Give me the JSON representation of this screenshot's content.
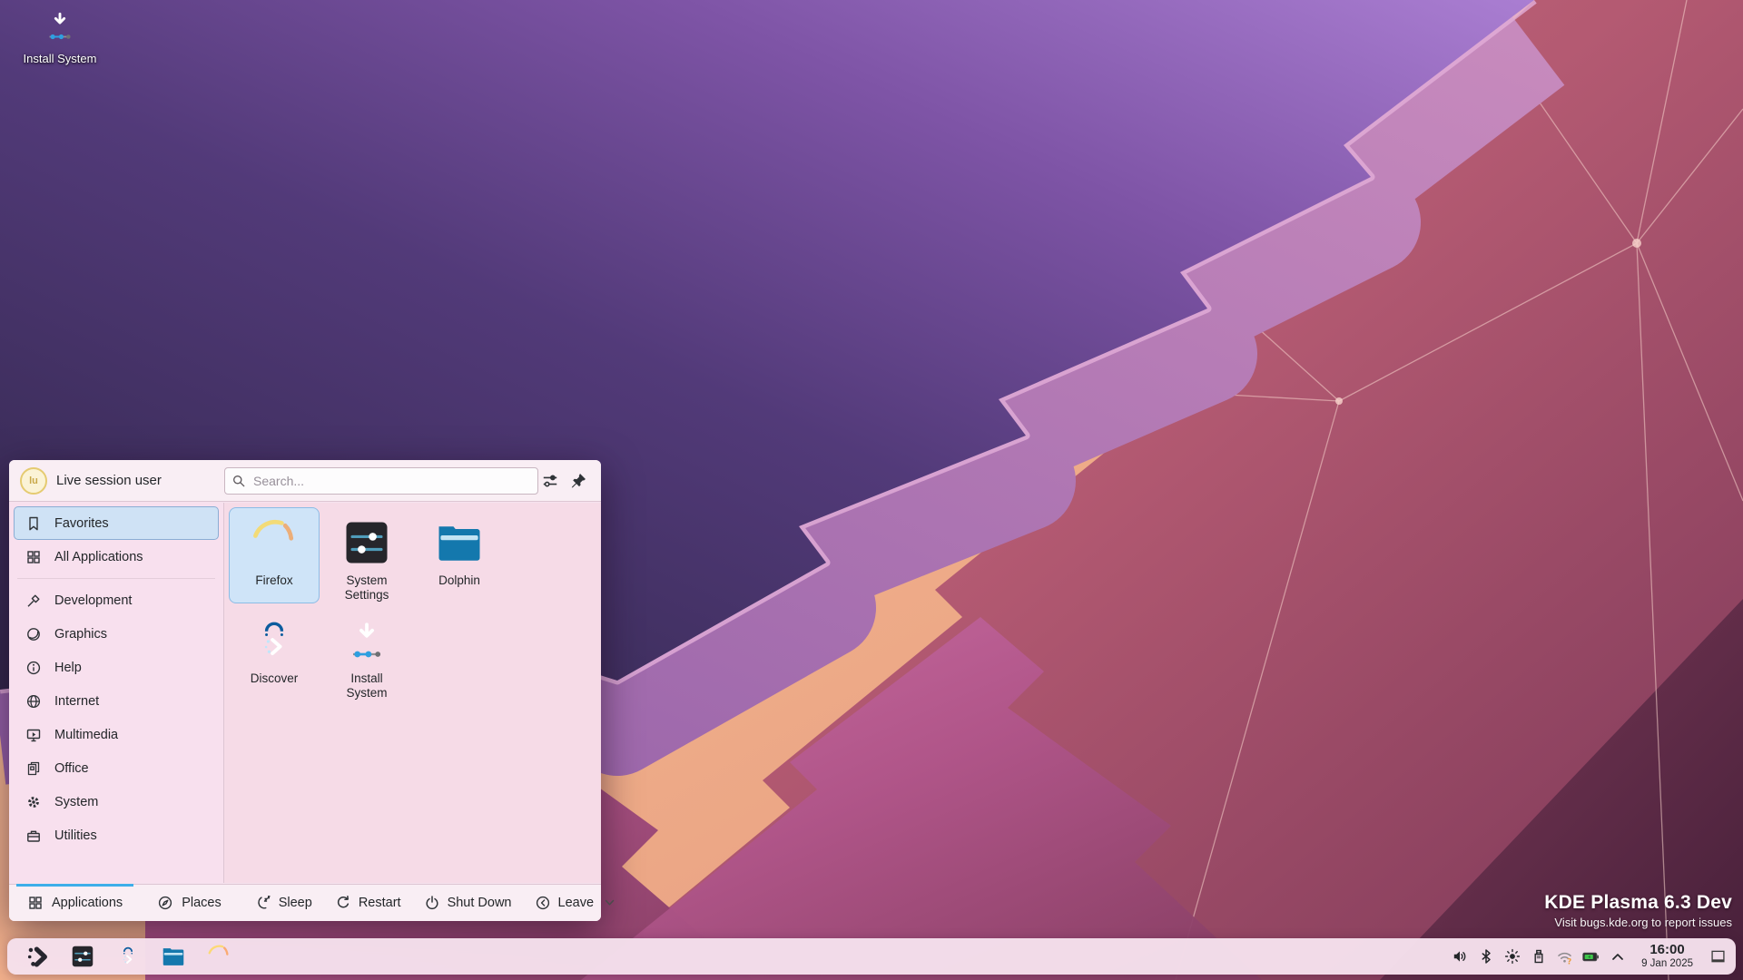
{
  "desktop": {
    "shortcut": {
      "label": "Install System"
    },
    "branding": {
      "title": "KDE Plasma 6.3 Dev",
      "subtitle": "Visit bugs.kde.org to report issues"
    }
  },
  "launcher": {
    "user_name": "Live session user",
    "avatar_initials": "lu",
    "search": {
      "placeholder": "Search..."
    },
    "header_icons": [
      {
        "name": "configure-icon"
      },
      {
        "name": "pin-icon"
      }
    ],
    "sidebar": {
      "items": [
        {
          "label": "Favorites",
          "icon": "bookmark",
          "selected": true
        },
        {
          "label": "All Applications",
          "icon": "grid",
          "selected": false
        },
        {
          "label": "Development",
          "icon": "hammer",
          "selected": false
        },
        {
          "label": "Graphics",
          "icon": "sphere",
          "selected": false
        },
        {
          "label": "Help",
          "icon": "info-circle",
          "selected": false
        },
        {
          "label": "Internet",
          "icon": "globe",
          "selected": false
        },
        {
          "label": "Multimedia",
          "icon": "monitor-play",
          "selected": false
        },
        {
          "label": "Office",
          "icon": "documents",
          "selected": false
        },
        {
          "label": "System",
          "icon": "gear",
          "selected": false
        },
        {
          "label": "Utilities",
          "icon": "toolbox",
          "selected": false
        }
      ]
    },
    "apps": [
      {
        "label": "Firefox",
        "selected": true
      },
      {
        "label": "System Settings",
        "selected": false
      },
      {
        "label": "Dolphin",
        "selected": false
      },
      {
        "label": "Discover",
        "selected": false
      },
      {
        "label": "Install System",
        "selected": false
      }
    ],
    "footer": {
      "tabs": [
        {
          "label": "Applications",
          "active": true
        },
        {
          "label": "Places",
          "active": false
        }
      ],
      "actions": [
        {
          "label": "Sleep",
          "has_menu": false
        },
        {
          "label": "Restart",
          "has_menu": false
        },
        {
          "label": "Shut Down",
          "has_menu": false
        },
        {
          "label": "Leave",
          "has_menu": true
        }
      ]
    }
  },
  "taskbar": {
    "pinned_apps": [
      {
        "label": "Application Launcher"
      },
      {
        "label": "System Settings"
      },
      {
        "label": "Discover"
      },
      {
        "label": "Dolphin"
      },
      {
        "label": "Firefox"
      }
    ],
    "tray": [
      {
        "name": "volume"
      },
      {
        "name": "bluetooth"
      },
      {
        "name": "brightness"
      },
      {
        "name": "removable-device"
      },
      {
        "name": "network"
      },
      {
        "name": "battery"
      },
      {
        "name": "expand-tray"
      }
    ],
    "clock": {
      "time": "16:00",
      "date": "9 Jan 2025"
    }
  },
  "colors": {
    "accent": "#3daee9",
    "selection_bg": "#cfe2f5",
    "selection_border": "#8badd4",
    "panel_bg": "#f5e0ec",
    "battery_green": "#3fc54b",
    "network_warn_orange": "#eb9d3e"
  }
}
